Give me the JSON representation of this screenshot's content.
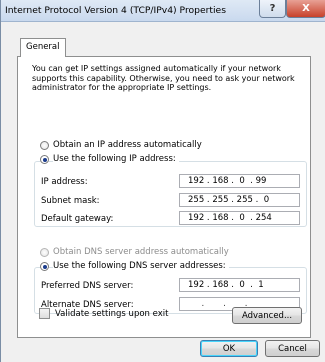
{
  "window": {
    "title": "Internet Protocol Version 4 (TCP/IPv4) Properties",
    "help_glyph": "?",
    "close_glyph": "X"
  },
  "tabs": [
    {
      "label": "General",
      "selected": true
    }
  ],
  "intro_text": "You can get IP settings assigned automatically if your network supports this capability. Otherwise, you need to ask your network administrator for the appropriate IP settings.",
  "ip_mode": {
    "auto_label": "Obtain an IP address automatically",
    "manual_label": "Use the following IP address:",
    "selected": "manual"
  },
  "ip_fields": {
    "ip_label": "IP address:",
    "ip_value": "192 . 168 .  0  . 99",
    "mask_label": "Subnet mask:",
    "mask_value": "255 . 255 . 255 .  0",
    "gateway_label": "Default gateway:",
    "gateway_value": "192 . 168 .  0  . 254"
  },
  "dns_mode": {
    "auto_label": "Obtain DNS server address automatically",
    "manual_label": "Use the following DNS server addresses:",
    "selected": "manual",
    "auto_disabled": true
  },
  "dns_fields": {
    "preferred_label": "Preferred DNS server:",
    "preferred_value": "192 . 168 .  0  .  1",
    "alternate_label": "Alternate DNS server:",
    "alternate_value": "     .       .       .     "
  },
  "validate": {
    "label": "Validate settings upon exit",
    "checked": false
  },
  "buttons": {
    "advanced": "Advanced...",
    "ok": "OK",
    "cancel": "Cancel"
  }
}
